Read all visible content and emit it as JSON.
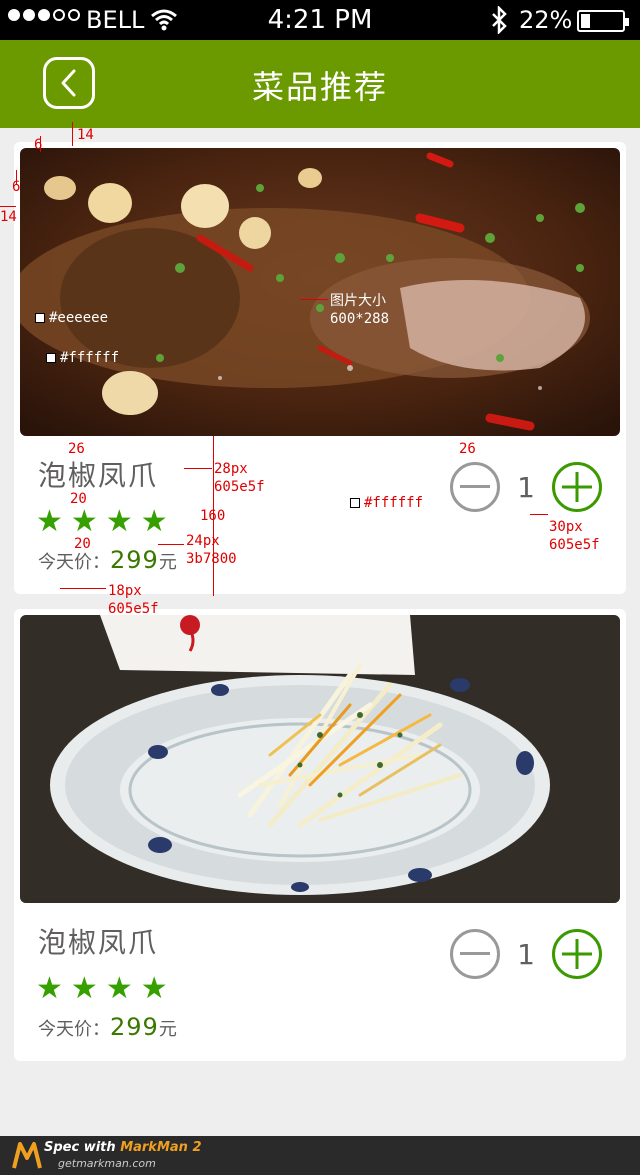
{
  "status_bar": {
    "carrier": "BELL",
    "time": "4:21 PM",
    "battery_percent": "22%",
    "battery_level": 0.22,
    "signal_bars_filled": 3,
    "signal_bars_total": 5
  },
  "header": {
    "title": "菜品推荐",
    "back_icon": "chevron-left-icon",
    "color": "#6b9900"
  },
  "dishes": [
    {
      "name": "泡椒凤爪",
      "rating": 4,
      "price_label": "今天价：",
      "price": "299",
      "price_unit": "元",
      "quantity": "1",
      "image": "braised-fish-photo"
    },
    {
      "name": "泡椒凤爪",
      "rating": 4,
      "price_label": "今天价：",
      "price": "299",
      "price_unit": "元",
      "quantity": "1",
      "image": "shredded-salad-plate-photo"
    }
  ],
  "annotations": {
    "m6a": "6",
    "m14a": "14",
    "m6b": "6",
    "m14b": "14",
    "bg_eee": "#eeeeee",
    "bg_fff1": "#ffffff",
    "img_size_label": "图片大小",
    "img_size_val": "600*288",
    "gap26a": "26",
    "gap26b": "26",
    "gap20a": "20",
    "gap20b": "20",
    "h160": "160",
    "name_size": "28px",
    "name_color": "605e5f",
    "price_size": "24px",
    "price_color": "3b7800",
    "label_size": "18px",
    "label_color": "605e5f",
    "card_bg": "#ffffff",
    "qty_size": "30px",
    "qty_color": "605e5f"
  },
  "footer": {
    "spec_prefix": "Spec with ",
    "spec_brand": "MarkMan 2",
    "site": "getmarkman.com"
  },
  "colors": {
    "accent_green": "#3b7800",
    "text_gray": "#605e5f",
    "star_green": "#35a000"
  }
}
